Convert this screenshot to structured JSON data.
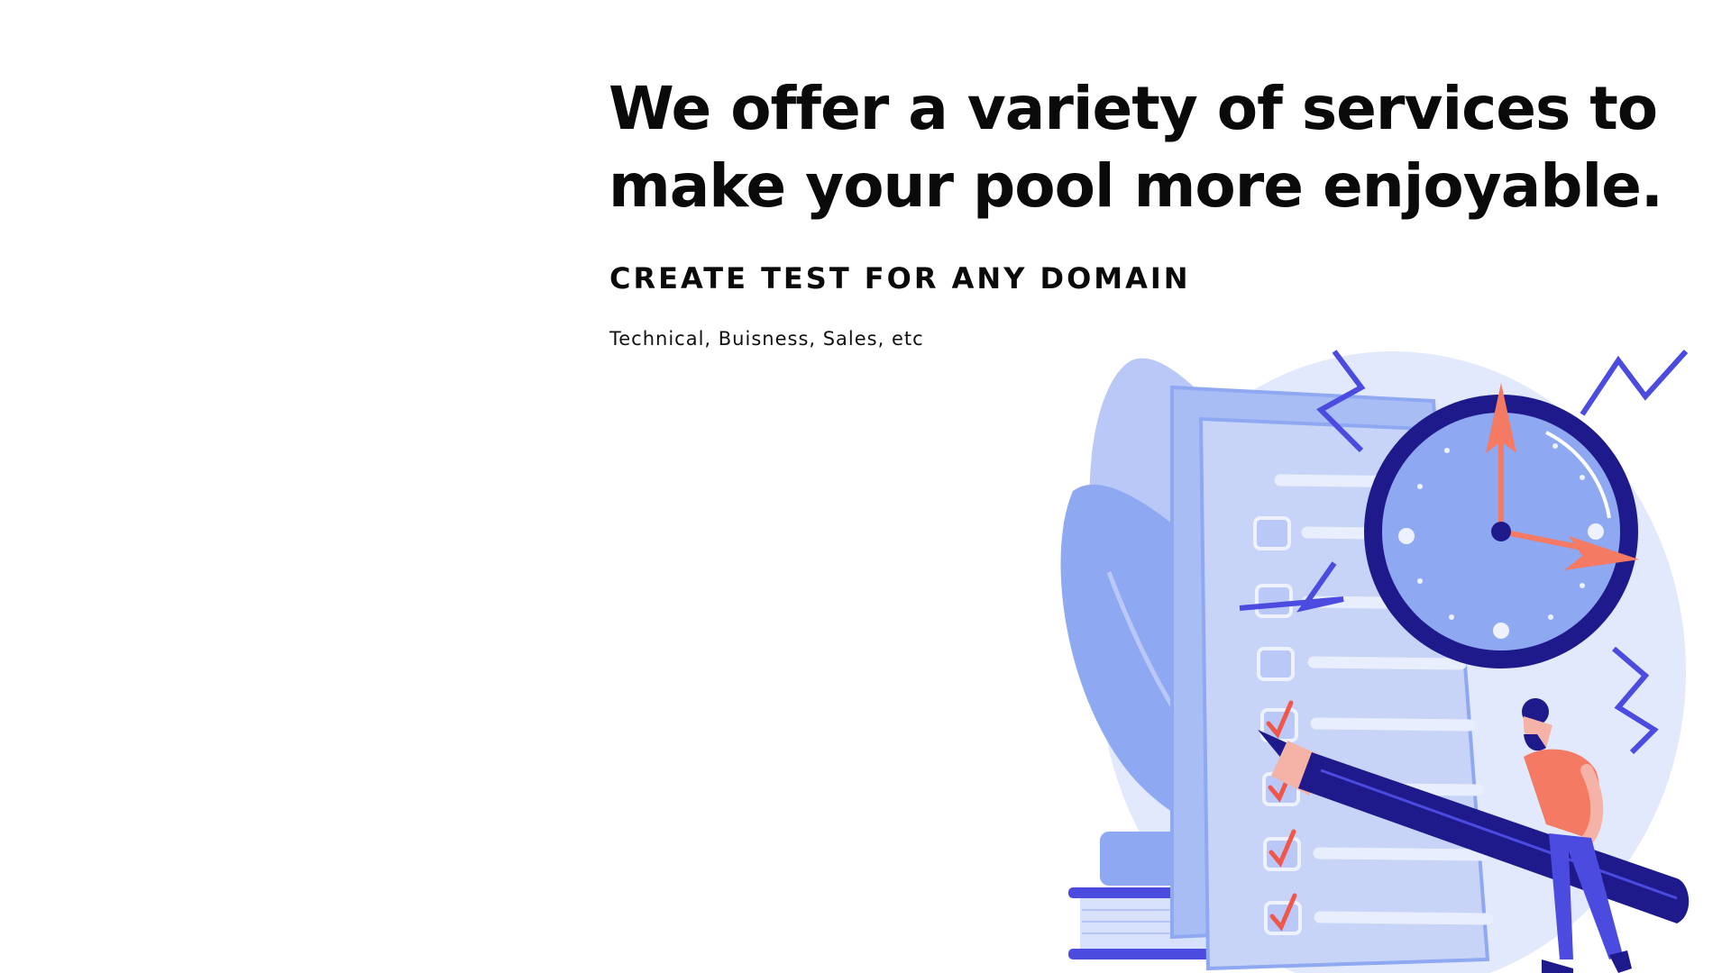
{
  "hero": {
    "headline_line1": "We offer a variety of services to",
    "headline_line2": "make your pool more enjoyable.",
    "subheading": "CREATE TEST FOR ANY DOMAIN",
    "caption": "Technical, Buisness, Sales, etc"
  },
  "illustration": {
    "subject": "checklist-clock-pencil-person",
    "checklist_items": [
      {
        "checked": false
      },
      {
        "checked": false
      },
      {
        "checked": false
      },
      {
        "checked": true
      },
      {
        "checked": true
      },
      {
        "checked": true
      },
      {
        "checked": true
      }
    ],
    "colors": {
      "light_blue": "#c7d4f8",
      "mid_blue": "#8fa8f2",
      "deep_blue": "#1f1a8c",
      "accent_coral": "#f47a64",
      "bg_circle": "#e3e9fc"
    }
  }
}
